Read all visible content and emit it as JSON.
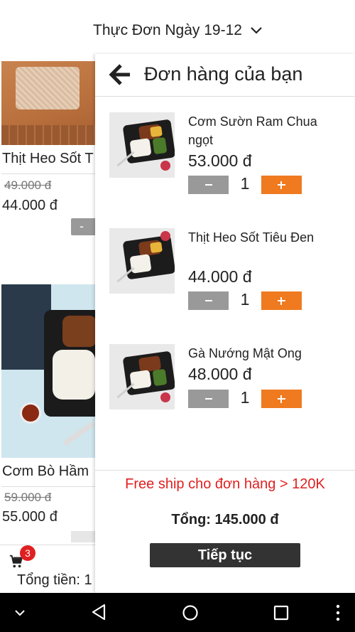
{
  "header": {
    "title": "Thực Đơn Ngày 19-12"
  },
  "background_list": {
    "items": [
      {
        "name": "Thịt Heo Sốt T",
        "old_price": "49.000 đ",
        "new_price": "44.000 đ",
        "minus_label": "-"
      },
      {
        "name": "Cơm Bò Hầm",
        "old_price": "59.000 đ",
        "new_price": "55.000 đ"
      }
    ],
    "cart": {
      "badge_count": "3",
      "total_label": "Tổng tiền: 1"
    }
  },
  "order_panel": {
    "title": "Đơn hàng của bạn",
    "items": [
      {
        "name": "Cơm Sườn Ram Chua ngọt",
        "price": "53.000 đ",
        "quantity": "1"
      },
      {
        "name": "Thịt Heo Sốt Tiêu Đen",
        "price": "44.000 đ",
        "quantity": "1"
      },
      {
        "name": "Gà Nướng Mật Ong",
        "price": "48.000 đ",
        "quantity": "1"
      }
    ],
    "promo_text": "Free ship cho đơn hàng > 120K",
    "total_text": "Tổng: 145.000 đ",
    "continue_label": "Tiếp tục"
  },
  "colors": {
    "accent_orange": "#ef7a1f",
    "promo_red": "#e02020",
    "button_dark": "#333333",
    "button_grey": "#999999"
  },
  "icons": [
    "chevron-down-icon",
    "back-arrow-icon",
    "cart-icon",
    "nav-collapse-icon",
    "nav-back-icon",
    "nav-home-icon",
    "nav-recents-icon",
    "nav-menu-icon"
  ]
}
